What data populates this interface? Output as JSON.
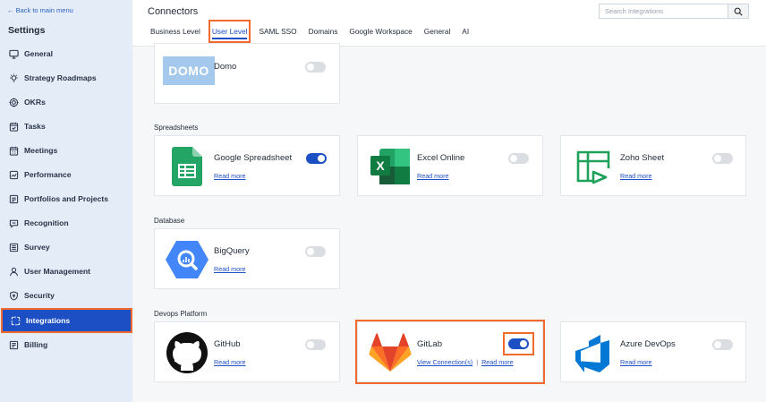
{
  "sidebar": {
    "back_link": "← Back to main menu",
    "title": "Settings",
    "items": [
      {
        "label": "General",
        "icon": "monitor-icon"
      },
      {
        "label": "Strategy Roadmaps",
        "icon": "bulb-icon"
      },
      {
        "label": "OKRs",
        "icon": "target-icon"
      },
      {
        "label": "Tasks",
        "icon": "calendar-check-icon"
      },
      {
        "label": "Meetings",
        "icon": "calendar-icon"
      },
      {
        "label": "Performance",
        "icon": "chart-icon"
      },
      {
        "label": "Portfolios and Projects",
        "icon": "folder-icon"
      },
      {
        "label": "Recognition",
        "icon": "message-icon"
      },
      {
        "label": "Survey",
        "icon": "list-icon"
      },
      {
        "label": "User Management",
        "icon": "user-icon"
      },
      {
        "label": "Security",
        "icon": "shield-icon"
      },
      {
        "label": "Integrations",
        "icon": "integrations-icon",
        "active": true
      },
      {
        "label": "Billing",
        "icon": "document-icon"
      }
    ]
  },
  "header": {
    "title": "Connectors",
    "search_placeholder": "Search Integrations",
    "tabs": [
      "Business Level",
      "User Level",
      "SAML SSO",
      "Domains",
      "Google Workspace",
      "General",
      "AI"
    ],
    "active_tab": "User Level"
  },
  "sections": {
    "spreadsheets": "Spreadsheets",
    "database": "Database",
    "devops": "Devops Platform"
  },
  "cards": {
    "domo": {
      "name": "Domo",
      "logo_text": "DOMO",
      "enabled": false
    },
    "google_spreadsheet": {
      "name": "Google Spreadsheet",
      "link": "Read more",
      "enabled": true
    },
    "excel_online": {
      "name": "Excel Online",
      "link": "Read more",
      "enabled": false
    },
    "zoho_sheet": {
      "name": "Zoho Sheet",
      "link": "Read more",
      "enabled": false
    },
    "bigquery": {
      "name": "BigQuery",
      "link": "Read more",
      "enabled": false
    },
    "github": {
      "name": "GitHub",
      "link": "Read more",
      "enabled": false
    },
    "gitlab": {
      "name": "GitLab",
      "link_connections": "View Connection(s)",
      "separator": "|",
      "link": "Read more",
      "enabled": true
    },
    "azure_devops": {
      "name": "Azure DevOps",
      "link": "Read more",
      "enabled": false
    }
  },
  "colors": {
    "accent": "#1d4fc4",
    "highlight": "#f26a2e",
    "sidebar_bg": "#e3ecf7"
  }
}
